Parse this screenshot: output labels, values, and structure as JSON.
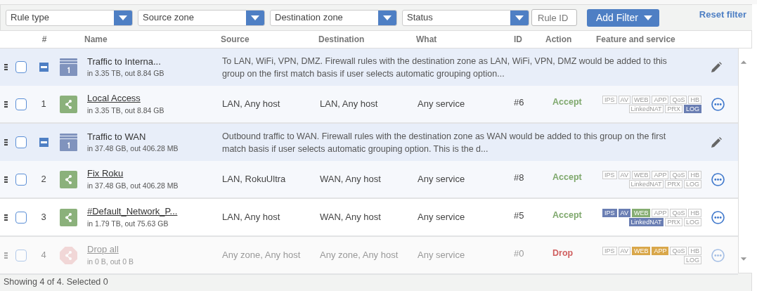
{
  "filters": {
    "selects": [
      {
        "placeholder": "Rule type"
      },
      {
        "placeholder": "Source zone"
      },
      {
        "placeholder": "Destination zone"
      },
      {
        "placeholder": "Status"
      }
    ],
    "rule_id": {
      "placeholder": "Rule ID"
    },
    "add_button": "Add Filter",
    "reset_link": "Reset filter"
  },
  "table": {
    "columns": [
      "#",
      "Name",
      "Source",
      "Destination",
      "What",
      "ID",
      "Action",
      "Feature and service"
    ],
    "rows": [
      {
        "kind": "group",
        "checked": false,
        "expanded": true,
        "name": "Traffic to Interna...",
        "traffic": "in 3.35 TB, out 8.84 GB",
        "description": "To LAN, WiFi, VPN, DMZ. Firewall rules with the destination zone as LAN, WiFi, VPN, DMZ would be added to this group on the first match basis if user selects automatic grouping option...",
        "children": [
          {
            "kind": "rule",
            "checked": false,
            "disabled": false,
            "number": "1",
            "name": "Local Access",
            "traffic": "in 3.35 TB, out 8.84 GB",
            "source": "LAN, Any host",
            "destination": "LAN, Any host",
            "what": "Any service",
            "id": "#6",
            "action": {
              "kind": "accept",
              "label": "Accept"
            },
            "features": [
              [
                {
                  "label": "IPS",
                  "on": false
                },
                {
                  "label": "AV",
                  "on": false
                },
                {
                  "label": "WEB",
                  "on": false
                },
                {
                  "label": "APP",
                  "on": false
                },
                {
                  "label": "QoS",
                  "on": false
                },
                {
                  "label": "HB",
                  "on": false
                }
              ],
              [
                {
                  "label": "LinkedNAT",
                  "on": false
                },
                {
                  "label": "PRX",
                  "on": false
                },
                {
                  "label": "LOG",
                  "on": true,
                  "color": "#6a7eb3"
                }
              ]
            ]
          }
        ]
      },
      {
        "kind": "group",
        "checked": false,
        "expanded": true,
        "name": "Traffic to WAN",
        "traffic": "in 37.48 GB, out 406.28 MB",
        "description": "Outbound traffic to WAN. Firewall rules with the destination zone as WAN would be added to this group on the first match basis if user selects automatic grouping option. This is the d...",
        "children": [
          {
            "kind": "rule",
            "checked": false,
            "disabled": false,
            "number": "2",
            "name": "Fix Roku",
            "traffic": "in 37.48 GB, out 406.28 MB",
            "source": "LAN, RokuUltra",
            "destination": "WAN, Any host",
            "what": "Any service",
            "id": "#8",
            "action": {
              "kind": "accept",
              "label": "Accept"
            },
            "features": [
              [
                {
                  "label": "IPS",
                  "on": false
                },
                {
                  "label": "AV",
                  "on": false
                },
                {
                  "label": "WEB",
                  "on": false
                },
                {
                  "label": "APP",
                  "on": false
                },
                {
                  "label": "QoS",
                  "on": false
                },
                {
                  "label": "HB",
                  "on": false
                }
              ],
              [
                {
                  "label": "LinkedNAT",
                  "on": false
                },
                {
                  "label": "PRX",
                  "on": false
                },
                {
                  "label": "LOG",
                  "on": false
                }
              ]
            ]
          }
        ]
      },
      {
        "kind": "rule",
        "checked": false,
        "disabled": false,
        "number": "3",
        "name": "#Default_Network_P...",
        "traffic": "in 1.79 TB, out 75.63 GB",
        "source": "LAN, Any host",
        "destination": "WAN, Any host",
        "what": "Any service",
        "id": "#5",
        "action": {
          "kind": "accept",
          "label": "Accept"
        },
        "features": [
          [
            {
              "label": "IPS",
              "on": true,
              "color": "#6a7eb3"
            },
            {
              "label": "AV",
              "on": true,
              "color": "#6a7eb3"
            },
            {
              "label": "WEB",
              "on": true,
              "color": "#86ad72"
            },
            {
              "label": "APP",
              "on": false
            },
            {
              "label": "QoS",
              "on": false
            },
            {
              "label": "HB",
              "on": false
            }
          ],
          [
            {
              "label": "LinkedNAT",
              "on": true,
              "color": "#6a7eb3"
            },
            {
              "label": "PRX",
              "on": false
            },
            {
              "label": "LOG",
              "on": false
            }
          ]
        ]
      },
      {
        "kind": "rule",
        "checked": false,
        "disabled": true,
        "number": "4",
        "name": "Drop all",
        "traffic": "in 0 B, out 0 B",
        "source": "Any zone, Any host",
        "destination": "Any zone, Any host",
        "what": "Any service",
        "id": "#0",
        "action": {
          "kind": "drop",
          "label": "Drop"
        },
        "features": [
          [
            {
              "label": "IPS",
              "on": false
            },
            {
              "label": "AV",
              "on": false
            },
            {
              "label": "WEB",
              "on": true,
              "color": "#d9a74a"
            },
            {
              "label": "APP",
              "on": true,
              "color": "#d9a74a"
            },
            {
              "label": "QoS",
              "on": false
            },
            {
              "label": "HB",
              "on": false
            }
          ],
          [
            {
              "label": "LOG",
              "on": false
            }
          ]
        ]
      }
    ]
  },
  "status_bar": "Showing 4 of 4. Selected 0"
}
